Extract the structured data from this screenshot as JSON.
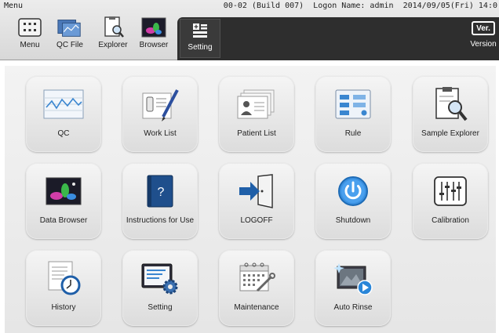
{
  "header": {
    "menu_title": "Menu",
    "status": "00-02 (Build 007)  Logon Name: admin  2014/09/05(Fri) 14:0"
  },
  "toolbar": [
    {
      "label": "Menu",
      "icon": "menu-grid-icon"
    },
    {
      "label": "QC File",
      "icon": "qc-file-icon"
    },
    {
      "label": "Explorer",
      "icon": "explorer-icon"
    },
    {
      "label": "Browser",
      "icon": "browser-icon"
    }
  ],
  "setting_tab": {
    "label": "Setting",
    "icon": "setting-tab-icon"
  },
  "version": {
    "badge": "Ver.",
    "label": "Version"
  },
  "tiles": [
    {
      "label": "QC",
      "icon": "qc-chart-icon"
    },
    {
      "label": "Work List",
      "icon": "work-list-icon"
    },
    {
      "label": "Patient List",
      "icon": "patient-list-icon"
    },
    {
      "label": "Rule",
      "icon": "rule-icon"
    },
    {
      "label": "Sample Explorer",
      "icon": "sample-explorer-icon"
    },
    {
      "label": "Data Browser",
      "icon": "data-browser-icon"
    },
    {
      "label": "Instructions for Use",
      "icon": "instructions-book-icon",
      "glyph": "?"
    },
    {
      "label": "LOGOFF",
      "icon": "logoff-door-icon"
    },
    {
      "label": "Shutdown",
      "icon": "power-icon"
    },
    {
      "label": "Calibration",
      "icon": "calibration-sliders-icon"
    },
    {
      "label": "History",
      "icon": "history-clock-icon"
    },
    {
      "label": "Setting",
      "icon": "setting-gear-icon"
    },
    {
      "label": "Maintenance",
      "icon": "maintenance-calendar-icon"
    },
    {
      "label": "Auto Rinse",
      "icon": "auto-rinse-icon"
    }
  ],
  "colors": {
    "topbar": "#e2e2e2",
    "dark_panel": "#2e2e2e",
    "accent_blue": "#2a7fd4",
    "tile_bg": "#e8e8e8"
  }
}
